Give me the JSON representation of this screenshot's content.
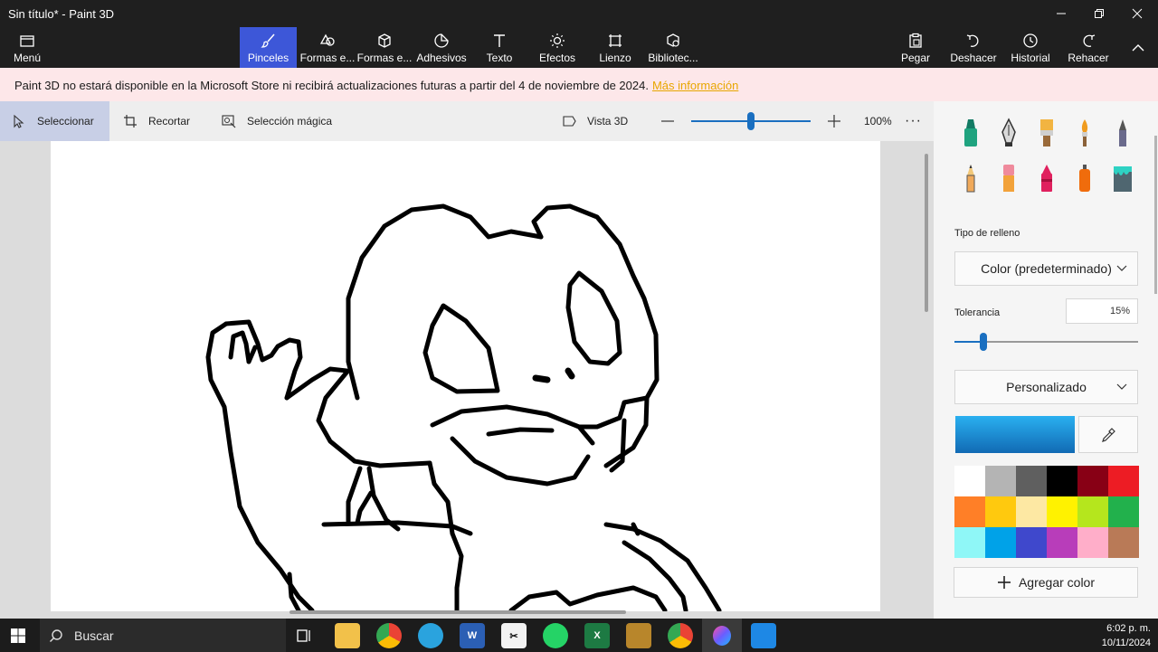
{
  "window": {
    "title": "Sin título* - Paint 3D"
  },
  "ribbon": {
    "menu": "Menú",
    "tools": [
      "Pinceles",
      "Formas e...",
      "Formas e...",
      "Adhesivos",
      "Texto",
      "Efectos",
      "Lienzo",
      "Bibliotec..."
    ],
    "actions": [
      "Pegar",
      "Deshacer",
      "Historial",
      "Rehacer"
    ]
  },
  "notice": {
    "text": "Paint 3D no estará disponible en la Microsoft Store ni recibirá actualizaciones futuras a partir del 4 de noviembre de 2024.",
    "link": "Más información"
  },
  "toolbar": {
    "select": "Seleccionar",
    "crop": "Recortar",
    "magic_select": "Selección mágica",
    "view3d": "Vista 3D",
    "zoom_level": "100%",
    "zoom_fraction": 0.5
  },
  "panel": {
    "fill_type_label": "Tipo de relleno",
    "fill_type_value": "Color (predeterminado)",
    "tolerance_label": "Tolerancia",
    "tolerance_value": "15%",
    "tolerance_fraction": 0.15,
    "palette_select": "Personalizado",
    "current_color_top": "#2ab0f0",
    "current_color_bottom": "#116ab4",
    "add_color": "Agregar color",
    "swatches": [
      "#ffffff",
      "#b4b4b4",
      "#5f5f5f",
      "#000000",
      "#880015",
      "#ed1c24",
      "#ff7f27",
      "#ffc90e",
      "#fde8a3",
      "#fff200",
      "#b5e61d",
      "#22b14c",
      "#8ff7f7",
      "#00a2e8",
      "#3f48cc",
      "#b83dba",
      "#ffaec9",
      "#b97a57"
    ]
  },
  "taskbar": {
    "search_placeholder": "Buscar",
    "time": "6:02 p. m.",
    "date": "10/11/2024"
  }
}
